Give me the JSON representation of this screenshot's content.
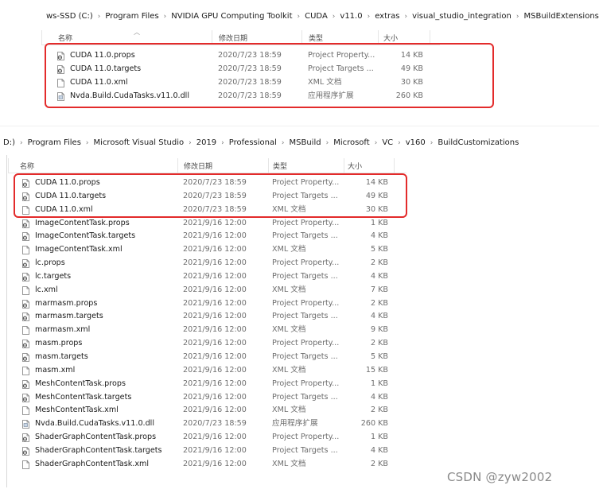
{
  "top": {
    "breadcrumb": [
      "ws-SSD (C:)",
      "Program Files",
      "NVIDIA GPU Computing Toolkit",
      "CUDA",
      "v11.0",
      "extras",
      "visual_studio_integration",
      "MSBuildExtensions"
    ],
    "columns": {
      "name": "名称",
      "date": "修改日期",
      "type": "类型",
      "size": "大小"
    },
    "files": [
      {
        "name": "CUDA 11.0.props",
        "date": "2020/7/23 18:59",
        "type": "Project Property...",
        "size": "14 KB",
        "icon": "project-file-icon"
      },
      {
        "name": "CUDA 11.0.targets",
        "date": "2020/7/23 18:59",
        "type": "Project Targets ...",
        "size": "49 KB",
        "icon": "project-file-icon"
      },
      {
        "name": "CUDA 11.0.xml",
        "date": "2020/7/23 18:59",
        "type": "XML 文档",
        "size": "30 KB",
        "icon": "document-icon"
      },
      {
        "name": "Nvda.Build.CudaTasks.v11.0.dll",
        "date": "2020/7/23 18:59",
        "type": "应用程序扩展",
        "size": "260 KB",
        "icon": "dll-icon"
      }
    ]
  },
  "bottom": {
    "breadcrumb": [
      "D:)",
      "Program Files",
      "Microsoft Visual Studio",
      "2019",
      "Professional",
      "MSBuild",
      "Microsoft",
      "VC",
      "v160",
      "BuildCustomizations"
    ],
    "columns": {
      "name": "名称",
      "date": "修改日期",
      "type": "类型",
      "size": "大小"
    },
    "files": [
      {
        "name": "CUDA 11.0.props",
        "date": "2020/7/23 18:59",
        "type": "Project Property...",
        "size": "14 KB",
        "icon": "project-file-icon"
      },
      {
        "name": "CUDA 11.0.targets",
        "date": "2020/7/23 18:59",
        "type": "Project Targets ...",
        "size": "49 KB",
        "icon": "project-file-icon"
      },
      {
        "name": "CUDA 11.0.xml",
        "date": "2020/7/23 18:59",
        "type": "XML 文档",
        "size": "30 KB",
        "icon": "document-icon"
      },
      {
        "name": "ImageContentTask.props",
        "date": "2021/9/16 12:00",
        "type": "Project Property...",
        "size": "1 KB",
        "icon": "project-file-icon"
      },
      {
        "name": "ImageContentTask.targets",
        "date": "2021/9/16 12:00",
        "type": "Project Targets ...",
        "size": "4 KB",
        "icon": "project-file-icon"
      },
      {
        "name": "ImageContentTask.xml",
        "date": "2021/9/16 12:00",
        "type": "XML 文档",
        "size": "5 KB",
        "icon": "document-icon"
      },
      {
        "name": "lc.props",
        "date": "2021/9/16 12:00",
        "type": "Project Property...",
        "size": "2 KB",
        "icon": "project-file-icon"
      },
      {
        "name": "lc.targets",
        "date": "2021/9/16 12:00",
        "type": "Project Targets ...",
        "size": "4 KB",
        "icon": "project-file-icon"
      },
      {
        "name": "lc.xml",
        "date": "2021/9/16 12:00",
        "type": "XML 文档",
        "size": "7 KB",
        "icon": "document-icon"
      },
      {
        "name": "marmasm.props",
        "date": "2021/9/16 12:00",
        "type": "Project Property...",
        "size": "2 KB",
        "icon": "project-file-icon"
      },
      {
        "name": "marmasm.targets",
        "date": "2021/9/16 12:00",
        "type": "Project Targets ...",
        "size": "4 KB",
        "icon": "project-file-icon"
      },
      {
        "name": "marmasm.xml",
        "date": "2021/9/16 12:00",
        "type": "XML 文档",
        "size": "9 KB",
        "icon": "document-icon"
      },
      {
        "name": "masm.props",
        "date": "2021/9/16 12:00",
        "type": "Project Property...",
        "size": "2 KB",
        "icon": "project-file-icon"
      },
      {
        "name": "masm.targets",
        "date": "2021/9/16 12:00",
        "type": "Project Targets ...",
        "size": "5 KB",
        "icon": "project-file-icon"
      },
      {
        "name": "masm.xml",
        "date": "2021/9/16 12:00",
        "type": "XML 文档",
        "size": "15 KB",
        "icon": "document-icon"
      },
      {
        "name": "MeshContentTask.props",
        "date": "2021/9/16 12:00",
        "type": "Project Property...",
        "size": "1 KB",
        "icon": "project-file-icon"
      },
      {
        "name": "MeshContentTask.targets",
        "date": "2021/9/16 12:00",
        "type": "Project Targets ...",
        "size": "4 KB",
        "icon": "project-file-icon"
      },
      {
        "name": "MeshContentTask.xml",
        "date": "2021/9/16 12:00",
        "type": "XML 文档",
        "size": "2 KB",
        "icon": "document-icon"
      },
      {
        "name": "Nvda.Build.CudaTasks.v11.0.dll",
        "date": "2020/7/23 18:59",
        "type": "应用程序扩展",
        "size": "260 KB",
        "icon": "dll-icon"
      },
      {
        "name": "ShaderGraphContentTask.props",
        "date": "2021/9/16 12:00",
        "type": "Project Property...",
        "size": "1 KB",
        "icon": "project-file-icon"
      },
      {
        "name": "ShaderGraphContentTask.targets",
        "date": "2021/9/16 12:00",
        "type": "Project Targets ...",
        "size": "4 KB",
        "icon": "project-file-icon"
      },
      {
        "name": "ShaderGraphContentTask.xml",
        "date": "2021/9/16 12:00",
        "type": "XML 文档",
        "size": "2 KB",
        "icon": "document-icon"
      }
    ]
  },
  "highlight_color": "#e32b2b",
  "watermark": "CSDN @zyw2002"
}
